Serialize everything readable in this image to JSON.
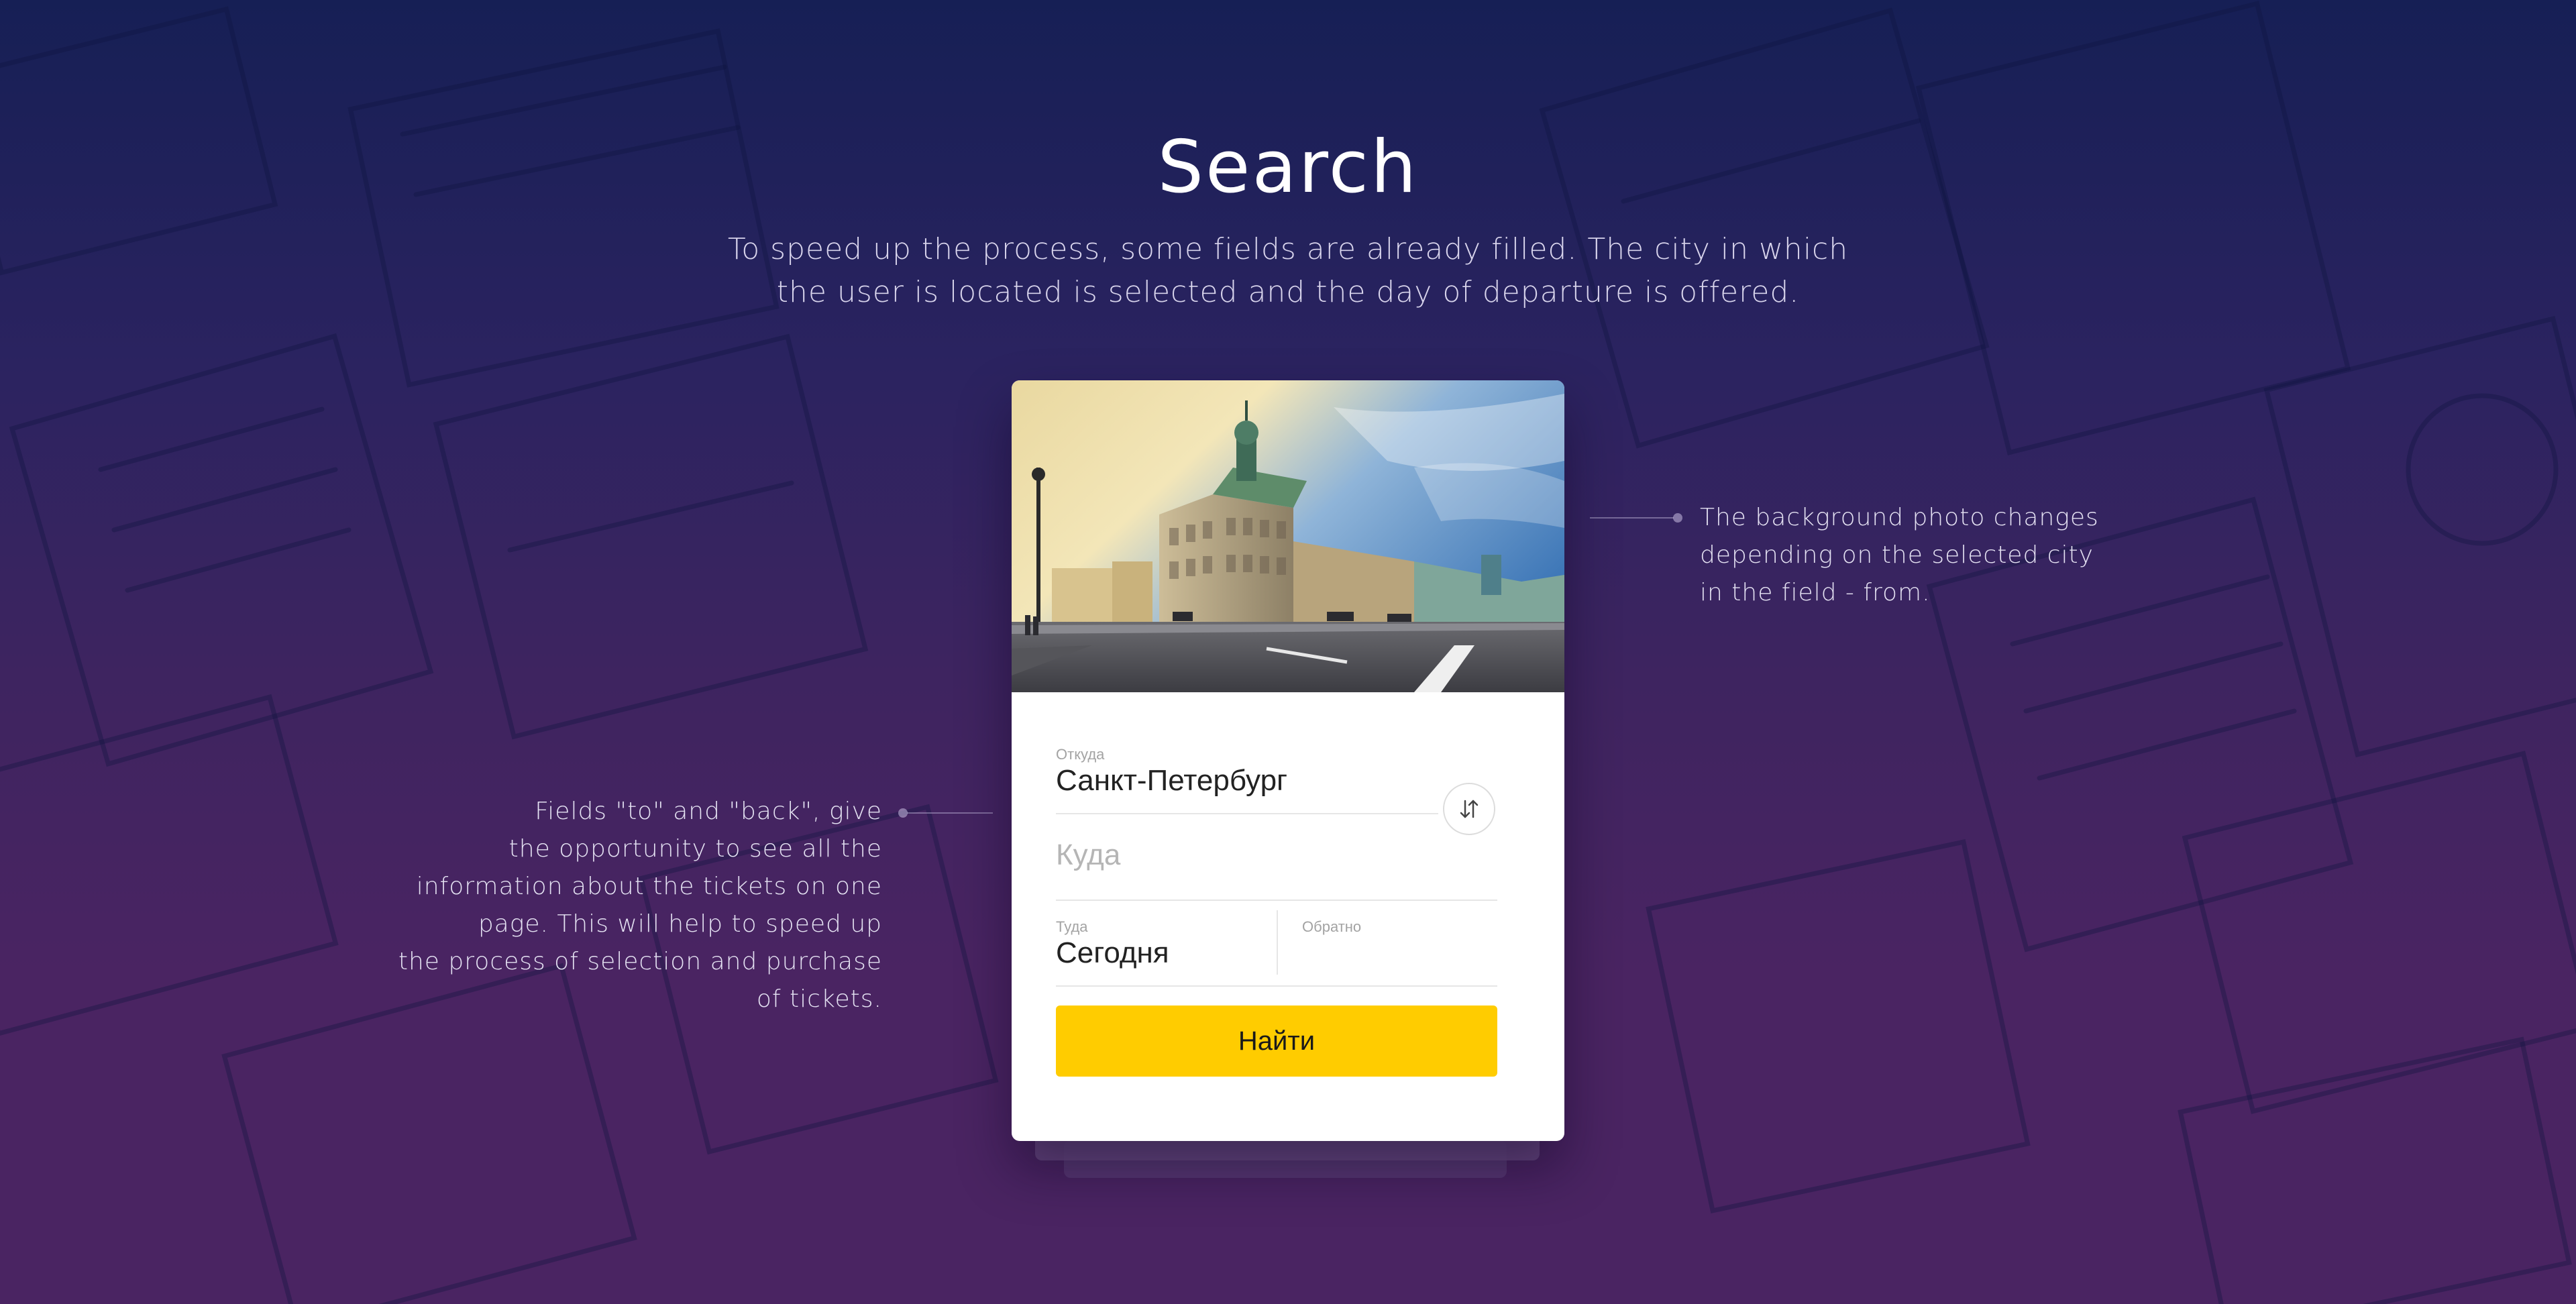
{
  "header": {
    "title": "Search",
    "subtitle_lines": [
      "To speed up the process, some fields are already filled. The city in which",
      "the user is located is selected and the day of departure is offered."
    ]
  },
  "card": {
    "photo_icon": "city-photo",
    "from": {
      "label": "Откуда",
      "value": "Санкт-Петербург"
    },
    "to": {
      "placeholder": "Куда"
    },
    "swap_icon": "swap-arrows-icon",
    "depart": {
      "label": "Туда",
      "value": "Сегодня"
    },
    "return": {
      "label": "Обратно",
      "value": ""
    },
    "search_label": "Найти"
  },
  "annotations": {
    "right_lines": [
      "The background photo changes",
      "depending on the selected city",
      "in the field - from."
    ],
    "left_lines": [
      "Fields \"to\" and \"back\", give",
      "the opportunity to see all the",
      "information about the tickets on one",
      "page. This will help to speed up",
      "the process of selection and purchase",
      "of tickets."
    ]
  },
  "colors": {
    "accent": "#ffcc00",
    "background_top": "#161f55",
    "background_bottom": "#4a2462"
  }
}
